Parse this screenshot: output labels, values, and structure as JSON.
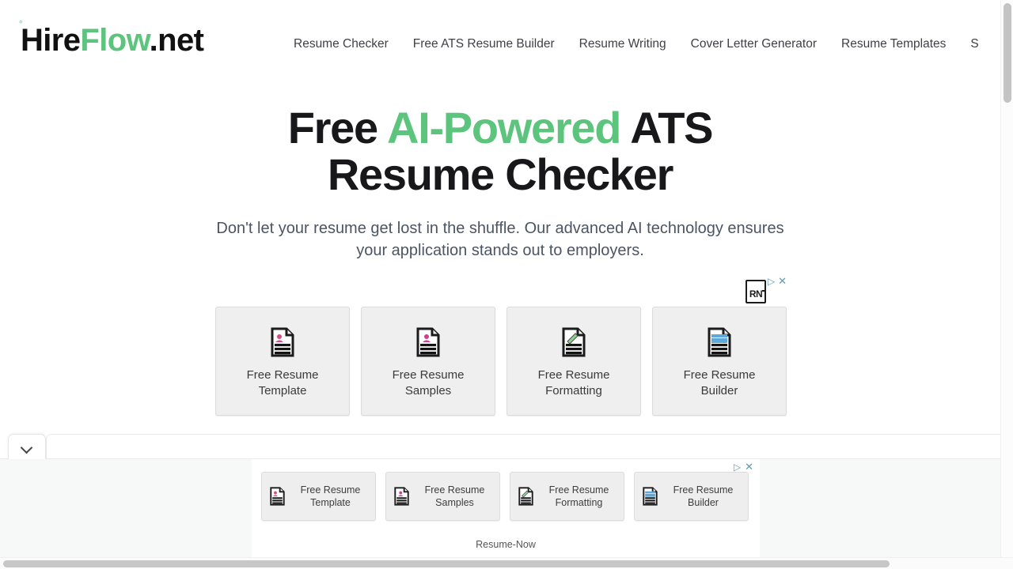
{
  "site": {
    "brand": {
      "part1": "Hire",
      "part2": "Flow",
      "part3": ".net",
      "mark": "°",
      "accent_color": "#5cc47c"
    },
    "nav": [
      {
        "label": "Resume Checker"
      },
      {
        "label": "Free ATS Resume Builder"
      },
      {
        "label": "Resume Writing"
      },
      {
        "label": "Cover Letter Generator"
      },
      {
        "label": "Resume Templates"
      },
      {
        "label": "S"
      }
    ]
  },
  "hero": {
    "title_part1": "Free ",
    "title_accent": "AI-Powered",
    "title_part2": " ATS Resume Checker",
    "subtitle": "Don't let your resume get lost in the shuffle. Our advanced AI technology ensures your application stands out to employers."
  },
  "ad_upper": {
    "advertiser_badge": "RN",
    "adchoices_icon": "adchoices-triangle-icon",
    "close_icon": "✕",
    "cards": [
      {
        "label": "Free Resume Template",
        "icon": "document-person-pink-icon",
        "accent": "#d94a86"
      },
      {
        "label": "Free Resume Samples",
        "icon": "document-person-pink-icon",
        "accent": "#cf3f8f"
      },
      {
        "label": "Free Resume Formatting",
        "icon": "document-pencil-green-icon",
        "accent": "#7bc47f"
      },
      {
        "label": "Free Resume Builder",
        "icon": "document-block-blue-icon",
        "accent": "#5fa8dc"
      }
    ]
  },
  "ad_band": {
    "advertiser": "Resume-Now",
    "adchoices_icon": "adchoices-triangle-icon",
    "close_icon": "✕",
    "cards": [
      {
        "label": "Free Resume Template",
        "icon": "document-person-pink-icon",
        "accent": "#d94a86"
      },
      {
        "label": "Free Resume Samples",
        "icon": "document-person-pink-icon",
        "accent": "#cf3f8f"
      },
      {
        "label": "Free Resume Formatting",
        "icon": "document-pencil-green-icon",
        "accent": "#7bc47f"
      },
      {
        "label": "Free Resume Builder",
        "icon": "document-block-blue-icon",
        "accent": "#5fa8dc"
      }
    ]
  },
  "drawer": {
    "toggle_icon": "chevron-down-icon"
  },
  "scrollbars": {
    "vertical_icon": "vertical-scrollbar",
    "horizontal_icon": "horizontal-scrollbar"
  }
}
